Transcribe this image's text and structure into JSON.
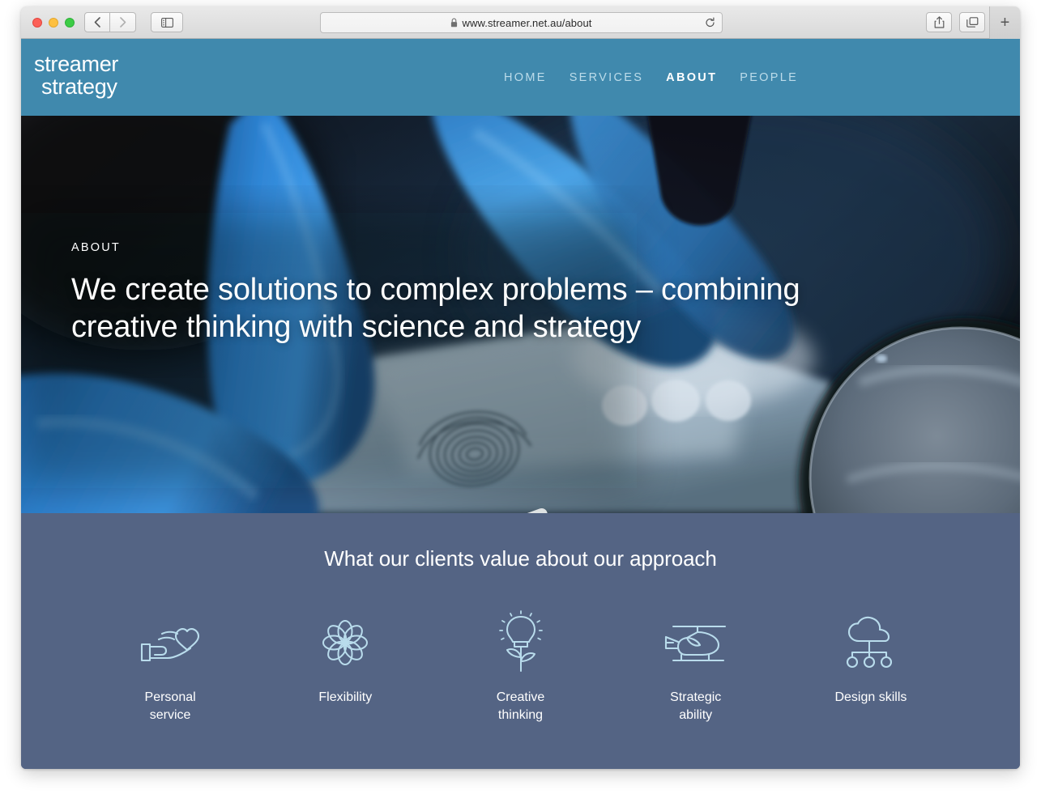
{
  "browser": {
    "url": "www.streamer.net.au/about",
    "lock_icon": "lock-icon",
    "back_label": "‹",
    "forward_label": "›",
    "reload_label": "reload-icon",
    "sidebar_label": "sidebar-icon",
    "share_label": "share-icon",
    "tabs_label": "tab-overview-icon",
    "new_tab_label": "+"
  },
  "site": {
    "logo_line1": "streamer",
    "logo_line2": "strategy",
    "header_color": "#4089ad",
    "nav": [
      {
        "label": "HOME",
        "active": false
      },
      {
        "label": "SERVICES",
        "active": false
      },
      {
        "label": "ABOUT",
        "active": true
      },
      {
        "label": "PEOPLE",
        "active": false
      }
    ]
  },
  "hero": {
    "eyebrow": "ABOUT",
    "title": "We create solutions to complex problems – combining creative thinking with science and strategy"
  },
  "values": {
    "heading": "What our clients value about our approach",
    "background_color": "#546484",
    "icon_color": "#b9dcec",
    "items": [
      {
        "icon": "hand-holding-heart-icon",
        "label": "Personal\nservice"
      },
      {
        "icon": "flower-rosette-icon",
        "label": "Flexibility"
      },
      {
        "icon": "lightbulb-plant-icon",
        "label": "Creative\nthinking"
      },
      {
        "icon": "helicopter-icon",
        "label": "Strategic\nability"
      },
      {
        "icon": "cloud-network-icon",
        "label": "Design skills"
      }
    ]
  }
}
